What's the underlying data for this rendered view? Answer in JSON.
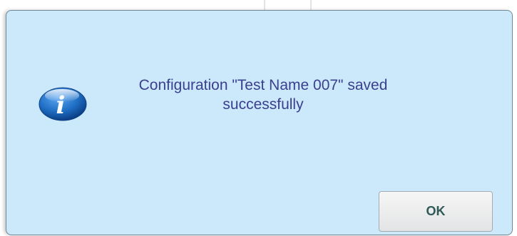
{
  "dialog": {
    "message": "Configuration \"Test Name 007\" saved successfully",
    "icon": "info-icon",
    "ok_label": "OK"
  },
  "colors": {
    "dialog_background": "#cbe9fb",
    "message_text": "#3b3f8f",
    "button_text": "#2f5a56",
    "icon_blue": "#1f6fc5"
  }
}
